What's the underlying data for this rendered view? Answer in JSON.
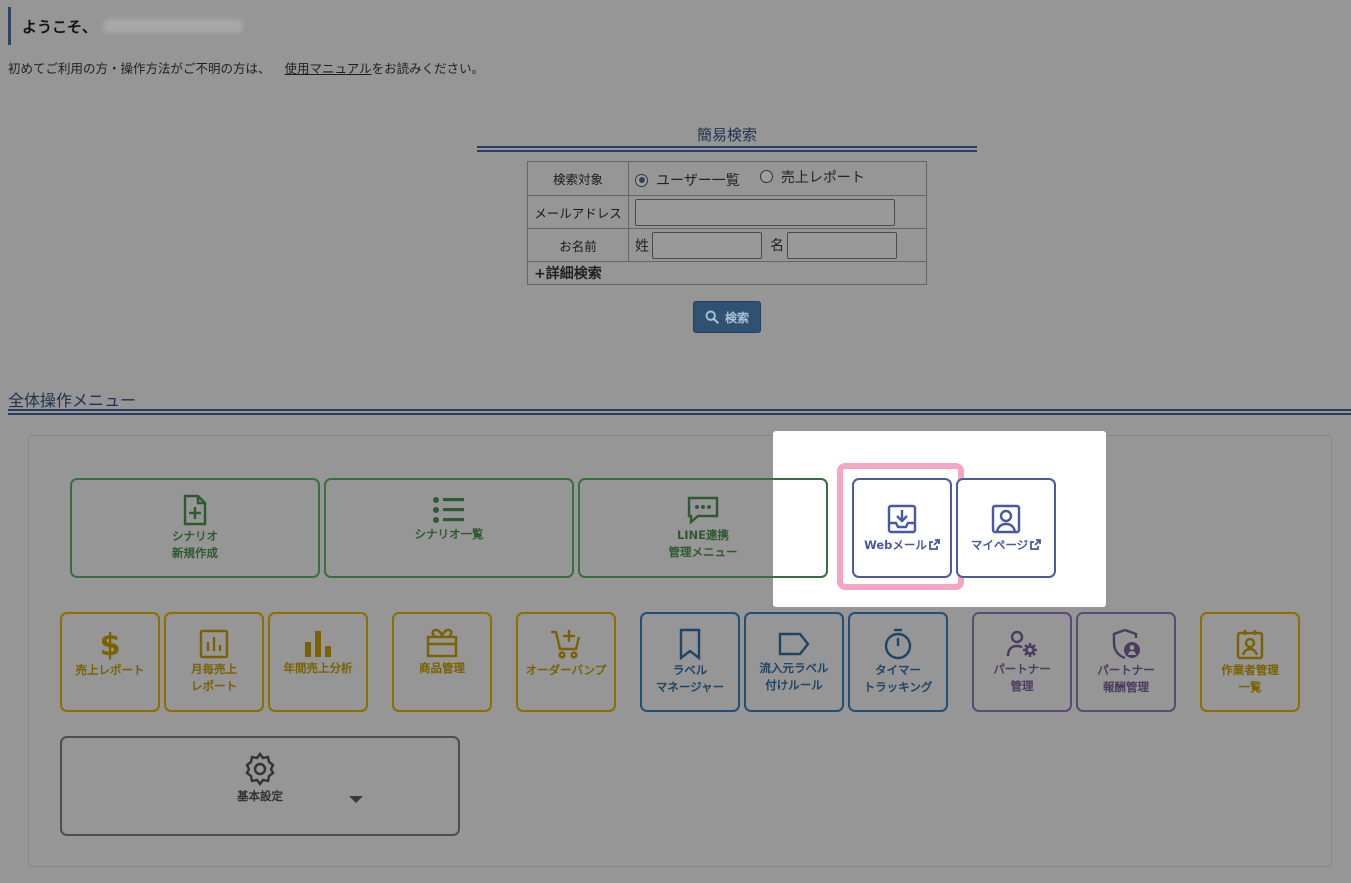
{
  "header": {
    "welcome": "ようこそ、",
    "intro_before": "初めてご利用の方・操作方法がご不明の方は、",
    "manual_link": "使用マニュアル",
    "intro_after": "をお読みください。"
  },
  "search": {
    "title": "簡易検索",
    "target_label": "検索対象",
    "options": [
      "ユーザー一覧",
      "売上レポート"
    ],
    "selected": "ユーザー一覧",
    "email_label": "メールアドレス",
    "email_value": "",
    "name_label": "お名前",
    "last_name_label": "姓",
    "first_name_label": "名",
    "last_name_value": "",
    "first_name_value": "",
    "detail_toggle": "+詳細検索",
    "button_label": "検索"
  },
  "menu": {
    "title": "全体操作メニュー",
    "row1": [
      {
        "label": "シナリオ\n新規作成",
        "icon": "file-plus-icon"
      },
      {
        "label": "シナリオ一覧",
        "icon": "list-icon"
      },
      {
        "label": "LINE連携\n管理メニュー",
        "icon": "chat-dots-icon"
      }
    ],
    "webmail": {
      "label": "Webメール",
      "icon": "inbox-download-icon"
    },
    "mypage": {
      "label": "マイページ",
      "icon": "person-card-icon"
    },
    "row2": [
      {
        "label": "売上レポート",
        "icon": "dollar-icon"
      },
      {
        "label": "月毎売上\nレポート",
        "icon": "bar-chart-box-icon"
      },
      {
        "label": "年間売上分析",
        "icon": "bar-chart-icon"
      },
      {
        "label": "商品管理",
        "icon": "gift-icon"
      },
      {
        "label": "オーダーバンプ",
        "icon": "cart-plus-icon"
      },
      {
        "label": "ラベル\nマネージャー",
        "icon": "bookmark-icon"
      },
      {
        "label": "流入元ラベル\n付けルール",
        "icon": "tag-icon"
      },
      {
        "label": "タイマー\nトラッキング",
        "icon": "stopwatch-icon"
      },
      {
        "label": "パートナー\n管理",
        "icon": "person-gear-icon"
      },
      {
        "label": "パートナー\n報酬管理",
        "icon": "shield-person-icon"
      },
      {
        "label": "作業者管理\n一覧",
        "icon": "id-badge-icon"
      }
    ],
    "settings": {
      "label": "基本設定",
      "icon": "gear-icon"
    }
  },
  "colors": {
    "background": "#969696",
    "green": "#3b6e3e",
    "yellow": "#8b7000",
    "blue": "#234f73",
    "purple": "#5c4973",
    "highlight_blue": "#4c5aa0",
    "highlight_pink": "#f4a6c4"
  }
}
